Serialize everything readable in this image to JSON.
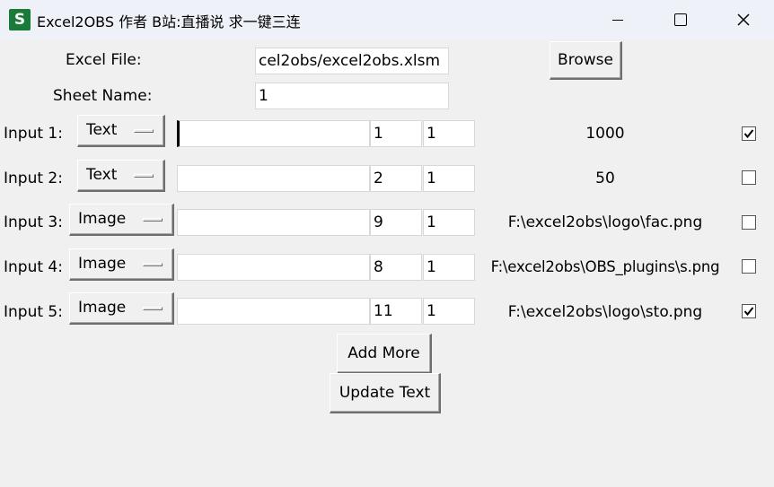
{
  "window": {
    "icon_letter": "S",
    "title": "Excel2OBS 作者 B站:直播说 求一键三连"
  },
  "form": {
    "excel_label": "Excel File:",
    "excel_value": "cel2obs/excel2obs.xlsm",
    "browse_label": "Browse",
    "sheet_label": "Sheet Name:",
    "sheet_value": "1"
  },
  "inputs": [
    {
      "label": "Input 1:",
      "type": "Text",
      "text": "",
      "row": "1",
      "col": "1",
      "value": "1000",
      "checked": true
    },
    {
      "label": "Input 2:",
      "type": "Text",
      "text": "",
      "row": "2",
      "col": "1",
      "value": "50",
      "checked": false
    },
    {
      "label": "Input 3:",
      "type": "Image",
      "text": "",
      "row": "9",
      "col": "1",
      "value": "F:\\excel2obs\\logo\\fac.png",
      "checked": false
    },
    {
      "label": "Input 4:",
      "type": "Image",
      "text": "",
      "row": "8",
      "col": "1",
      "value": "F:\\excel2obs\\OBS_plugins\\s.png",
      "checked": false
    },
    {
      "label": "Input 5:",
      "type": "Image",
      "text": "",
      "row": "11",
      "col": "1",
      "value": "F:\\excel2obs\\logo\\sto.png",
      "checked": true
    }
  ],
  "actions": {
    "add_more_label": "Add More",
    "update_text_label": "Update Text"
  }
}
